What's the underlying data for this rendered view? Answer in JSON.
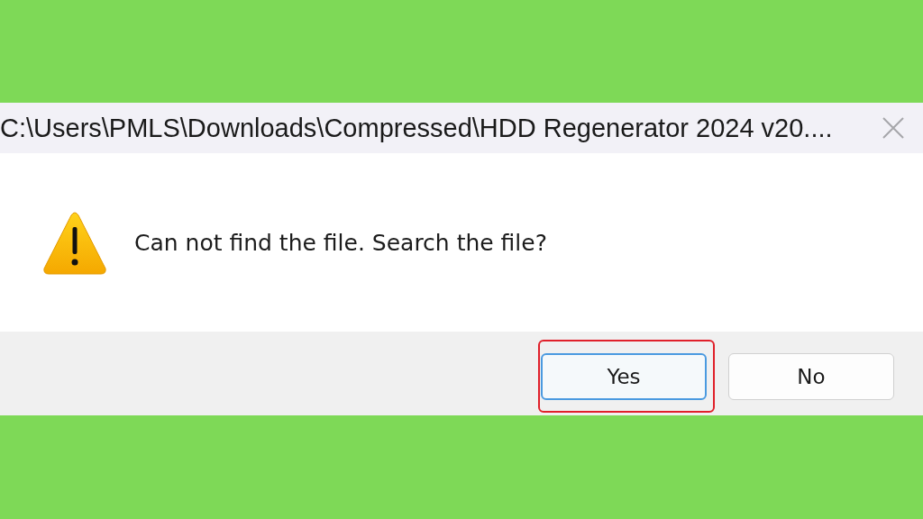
{
  "window": {
    "title": "C:\\Users\\PMLS\\Downloads\\Compressed\\HDD Regenerator 2024 v20...."
  },
  "message": {
    "text": "Can not find the file. Search the file?"
  },
  "buttons": [
    {
      "label": "Yes",
      "focused": true,
      "highlighted": true
    },
    {
      "label": "No",
      "focused": false,
      "highlighted": false
    }
  ]
}
